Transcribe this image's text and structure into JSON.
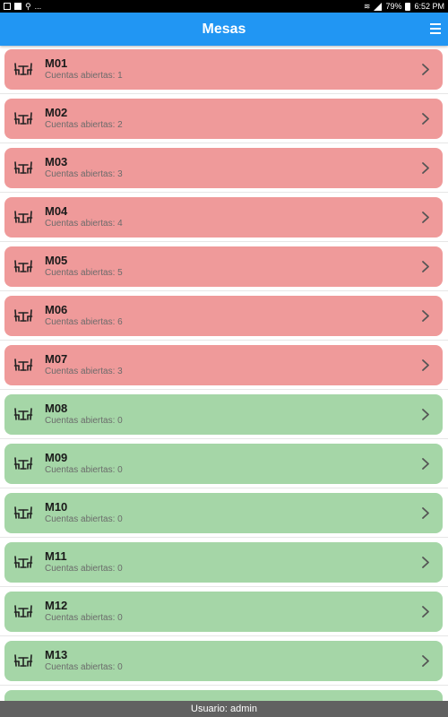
{
  "status_bar": {
    "left_extra": "...",
    "battery_text": "79%",
    "time": "6:52 PM"
  },
  "app_bar": {
    "title": "Mesas",
    "menu_icon": "hamburger-menu-icon"
  },
  "colors": {
    "app_bar": "#2196f3",
    "open_row": "#ef9a9a",
    "free_row": "#a5d6a7",
    "footer": "#616161"
  },
  "tables": [
    {
      "name": "M01",
      "status_text": "Cuentas abiertas: 1",
      "open_accounts": 1
    },
    {
      "name": "M02",
      "status_text": "Cuentas abiertas: 2",
      "open_accounts": 2
    },
    {
      "name": "M03",
      "status_text": "Cuentas abiertas: 3",
      "open_accounts": 3
    },
    {
      "name": "M04",
      "status_text": "Cuentas abiertas: 4",
      "open_accounts": 4
    },
    {
      "name": "M05",
      "status_text": "Cuentas abiertas: 5",
      "open_accounts": 5
    },
    {
      "name": "M06",
      "status_text": "Cuentas abiertas: 6",
      "open_accounts": 6
    },
    {
      "name": "M07",
      "status_text": "Cuentas abiertas: 3",
      "open_accounts": 3
    },
    {
      "name": "M08",
      "status_text": "Cuentas abiertas: 0",
      "open_accounts": 0
    },
    {
      "name": "M09",
      "status_text": "Cuentas abiertas: 0",
      "open_accounts": 0
    },
    {
      "name": "M10",
      "status_text": "Cuentas abiertas: 0",
      "open_accounts": 0
    },
    {
      "name": "M11",
      "status_text": "Cuentas abiertas: 0",
      "open_accounts": 0
    },
    {
      "name": "M12",
      "status_text": "Cuentas abiertas: 0",
      "open_accounts": 0
    },
    {
      "name": "M13",
      "status_text": "Cuentas abiertas: 0",
      "open_accounts": 0
    },
    {
      "name": "",
      "status_text": "",
      "open_accounts": 0
    }
  ],
  "footer": {
    "user_text": "Usuario: admin"
  }
}
